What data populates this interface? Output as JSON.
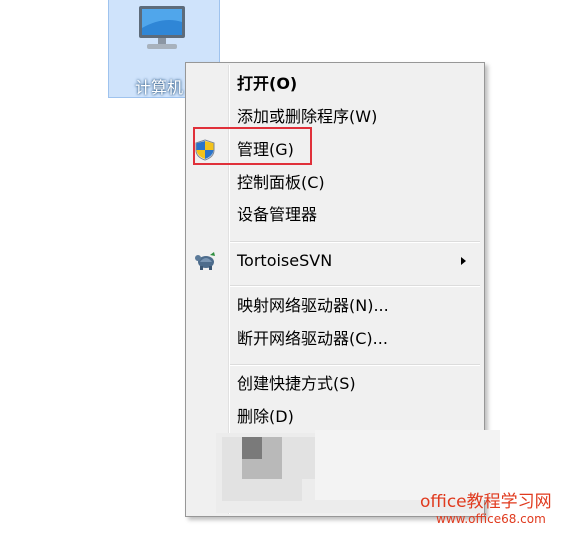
{
  "desktop_icon": {
    "label": "计算机"
  },
  "context_menu": {
    "items": [
      {
        "label": "打开(O)"
      },
      {
        "label": "添加或删除程序(W)"
      },
      {
        "label": "管理(G)"
      },
      {
        "label": "控制面板(C)"
      },
      {
        "label": "设备管理器"
      },
      {
        "label": "TortoiseSVN"
      },
      {
        "label": "映射网络驱动器(N)..."
      },
      {
        "label": "断开网络驱动器(C)..."
      },
      {
        "label": "创建快捷方式(S)"
      },
      {
        "label": "删除(D)"
      }
    ]
  },
  "watermark": {
    "title": "office教程学习网",
    "url": "www.office68.com"
  },
  "colors": {
    "highlight_border": "#e0303a",
    "watermark": "#e03a1e",
    "selection": "#cfe3fb"
  },
  "icons": {
    "manage": "uac-shield-icon",
    "tortoise": "tortoisesvn-icon",
    "computer": "computer-monitor-icon"
  }
}
